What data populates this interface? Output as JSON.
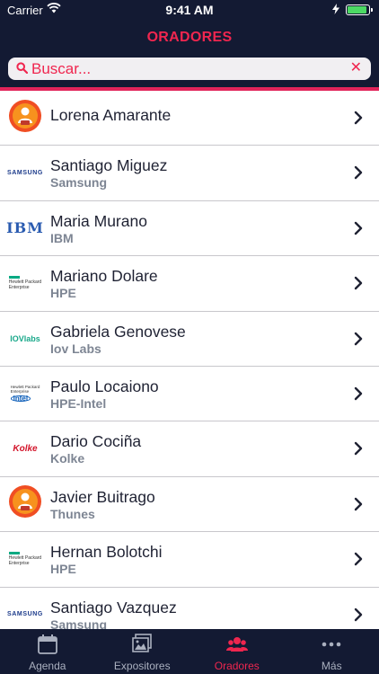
{
  "status_bar": {
    "carrier": "Carrier",
    "time": "9:41 AM",
    "battery_level": 0.9
  },
  "header": {
    "title": "ORADORES"
  },
  "search": {
    "placeholder": "Buscar..."
  },
  "speakers": [
    {
      "name": "Lorena Amarante",
      "company": "",
      "logo": "person-badge-icon"
    },
    {
      "name": "Santiago Miguez",
      "company": "Samsung",
      "logo": "samsung-logo"
    },
    {
      "name": "Maria Murano",
      "company": "IBM",
      "logo": "ibm-logo"
    },
    {
      "name": "Mariano Dolare",
      "company": "HPE",
      "logo": "hpe-logo"
    },
    {
      "name": "Gabriela Genovese",
      "company": "Iov Labs",
      "logo": "iovlabs-logo"
    },
    {
      "name": "Paulo Locaiono",
      "company": "HPE-Intel",
      "logo": "hpe-intel-logo"
    },
    {
      "name": "Dario Cociña",
      "company": "Kolke",
      "logo": "kolke-logo"
    },
    {
      "name": "Javier Buitrago",
      "company": "Thunes",
      "logo": "person-badge-icon"
    },
    {
      "name": "Hernan Bolotchi",
      "company": "HPE",
      "logo": "hpe-logo"
    },
    {
      "name": "Santiago Vazquez",
      "company": "Samsung",
      "logo": "samsung-logo"
    }
  ],
  "logo_texts": {
    "samsung": "SAMSUNG",
    "ibm": "IBM",
    "hpe_line1": "Hewlett Packard",
    "hpe_line2": "Enterprise",
    "iov": "IOVlabs",
    "kolke": "Kolke",
    "intel": "intel"
  },
  "tabs": [
    {
      "label": "Agenda",
      "icon": "calendar-icon",
      "active": false
    },
    {
      "label": "Expositores",
      "icon": "photos-icon",
      "active": false
    },
    {
      "label": "Oradores",
      "icon": "people-icon",
      "active": true
    },
    {
      "label": "Más",
      "icon": "more-dots-icon",
      "active": false
    }
  ],
  "colors": {
    "header_bg": "#131a33",
    "accent": "#f0264f",
    "text": "#1f2233",
    "subtext": "#7d8593",
    "tab_inactive": "#aab0bf"
  }
}
